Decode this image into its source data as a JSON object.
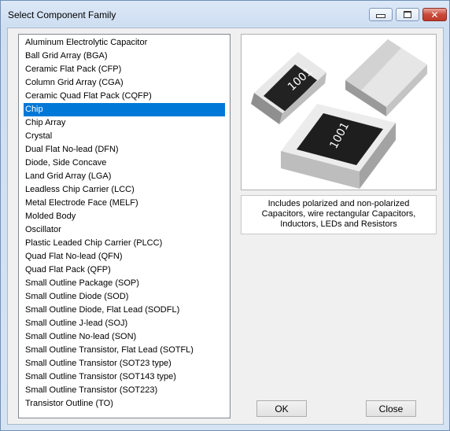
{
  "window": {
    "title": "Select Component Family"
  },
  "list": {
    "items": [
      "Aluminum Electrolytic Capacitor",
      "Ball Grid Array (BGA)",
      "Ceramic Flat Pack (CFP)",
      "Column Grid Array (CGA)",
      "Ceramic Quad Flat Pack (CQFP)",
      "Chip",
      "Chip Array",
      "Crystal",
      "Dual Flat No-lead (DFN)",
      "Diode, Side Concave",
      "Land Grid Array (LGA)",
      "Leadless Chip Carrier (LCC)",
      "Metal Electrode Face (MELF)",
      "Molded Body",
      "Oscillator",
      "Plastic Leaded Chip Carrier (PLCC)",
      "Quad Flat No-lead (QFN)",
      "Quad Flat Pack (QFP)",
      "Small Outline Package (SOP)",
      "Small Outline Diode (SOD)",
      "Small Outline Diode, Flat Lead (SODFL)",
      "Small Outline J-lead (SOJ)",
      "Small Outline No-lead (SON)",
      "Small Outline Transistor, Flat Lead (SOTFL)",
      "Small Outline Transistor (SOT23 type)",
      "Small Outline Transistor (SOT143 type)",
      "Small Outline Transistor (SOT223)",
      "Transistor Outline (TO)"
    ],
    "selected": "Chip"
  },
  "preview": {
    "chip_marking": "1001"
  },
  "description": "Includes polarized and non-polarized Capacitors, wire rectangular Capacitors, Inductors, LEDs and Resistors",
  "buttons": {
    "ok": "OK",
    "close": "Close"
  },
  "colors": {
    "selection": "#0078d7",
    "close_button": "#c84a3a"
  }
}
